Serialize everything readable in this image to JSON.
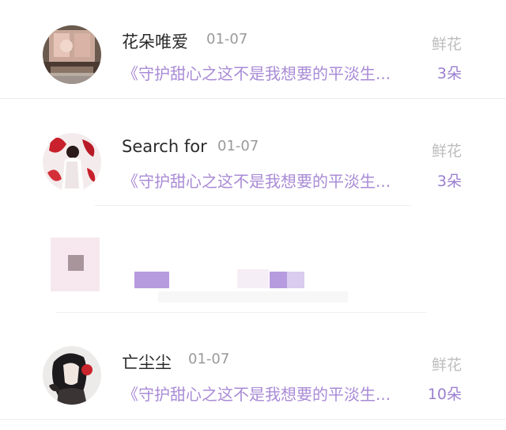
{
  "records": [
    {
      "user": "花朵唯爱",
      "date": "01-07",
      "gift_type": "鲜花",
      "book": "《守护甜心之这不是我想要的平淡生...",
      "count": "3朵",
      "avatar_icon": "room-scene-avatar"
    },
    {
      "user": "Search for",
      "date": "01-07",
      "gift_type": "鲜花",
      "book": "《守护甜心之这不是我想要的平淡生...",
      "count": "3朵",
      "avatar_icon": "red-white-anime-avatar"
    },
    {
      "user": "亡尘尘",
      "date": "01-07",
      "gift_type": "鲜花",
      "book": "《守护甜心之这不是我想要的平淡生...",
      "count": "10朵",
      "avatar_icon": "dark-hair-anime-avatar"
    }
  ],
  "colors": {
    "accent_purple": "#a98bd6",
    "count_purple": "#9b7fd0",
    "muted_gray": "#bdbdbd",
    "name_text": "#2a2a2a"
  }
}
